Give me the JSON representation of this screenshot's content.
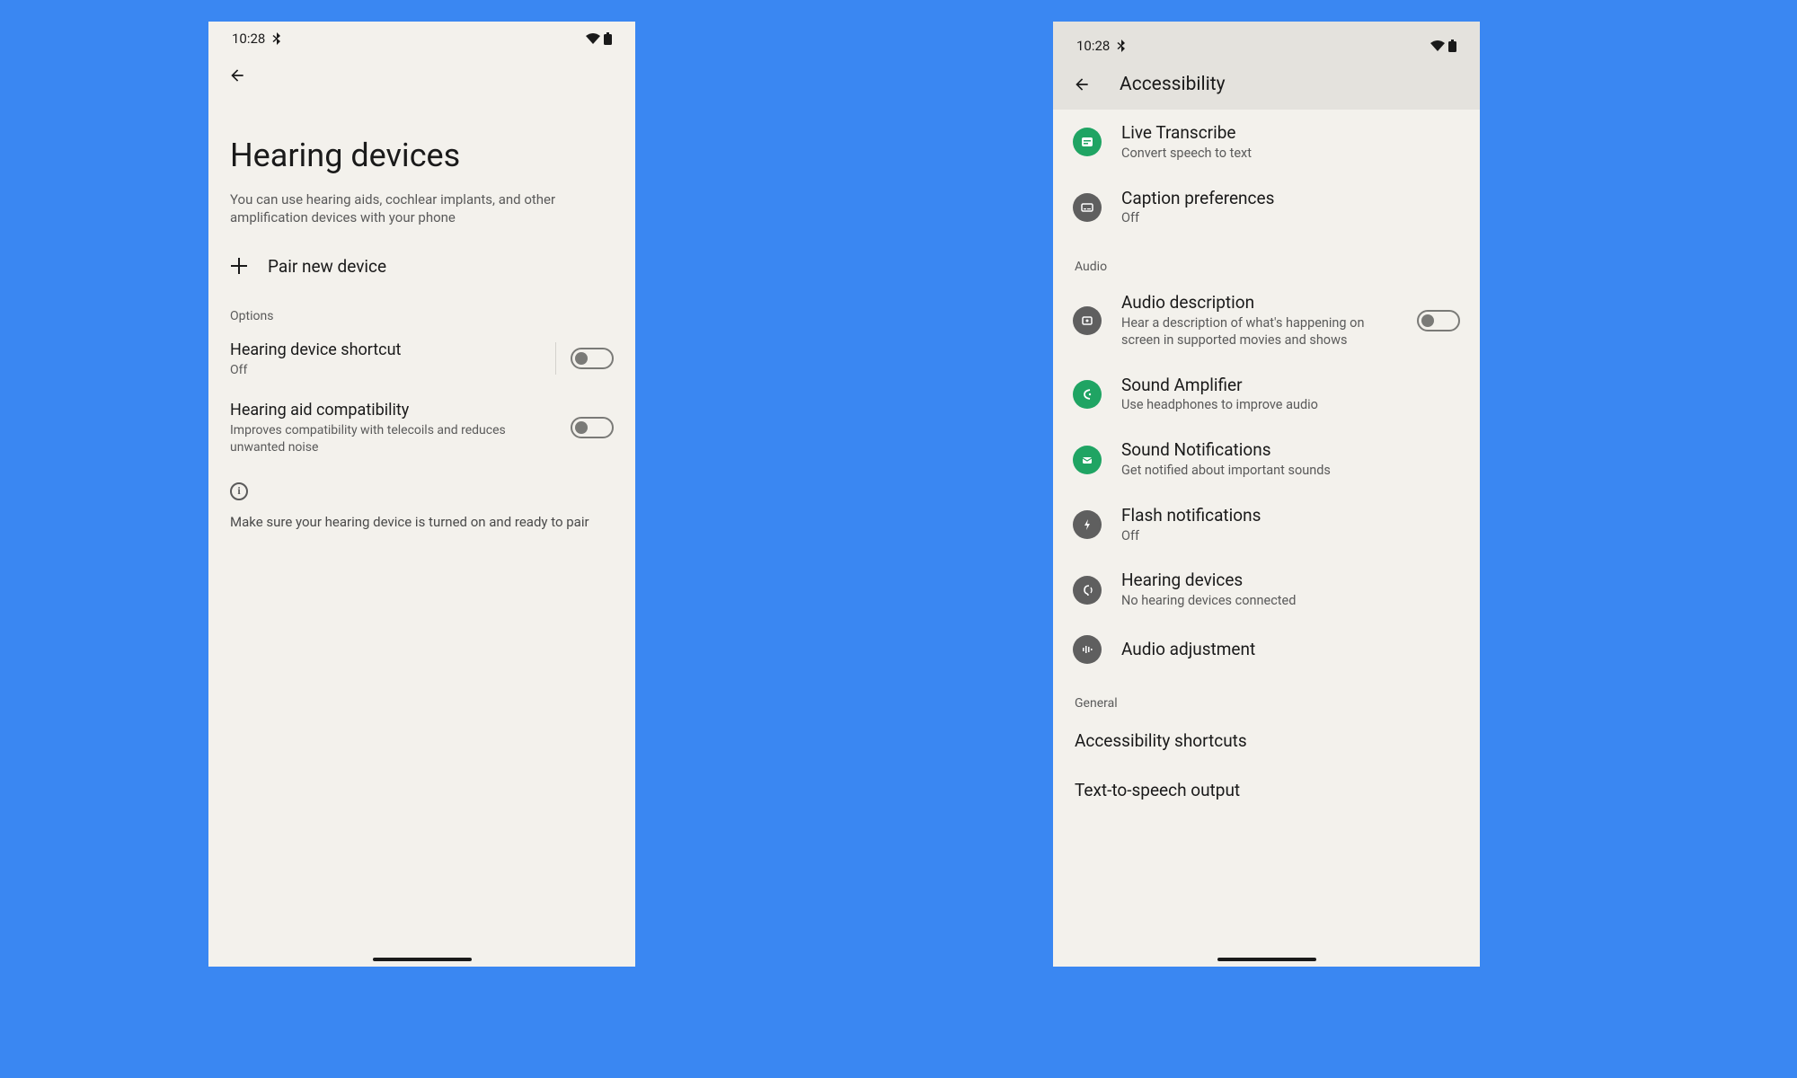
{
  "status": {
    "time": "10:28"
  },
  "left": {
    "title": "Hearing devices",
    "subtitle": "You can use hearing aids, cochlear implants, and other amplification devices with your phone",
    "pair": "Pair new device",
    "options_caption": "Options",
    "shortcut": {
      "title": "Hearing device shortcut",
      "sub": "Off"
    },
    "compat": {
      "title": "Hearing aid compatibility",
      "sub": "Improves compatibility with telecoils and reduces unwanted noise"
    },
    "info": "Make sure your hearing device is turned on and ready to pair"
  },
  "right": {
    "header": "Accessibility",
    "live_transcribe": {
      "title": "Live Transcribe",
      "sub": "Convert speech to text"
    },
    "caption_prefs": {
      "title": "Caption preferences",
      "sub": "Off"
    },
    "audio_caption": "Audio",
    "audio_desc": {
      "title": "Audio description",
      "sub": "Hear a description of what's happening on screen in supported movies and shows"
    },
    "sound_amp": {
      "title": "Sound Amplifier",
      "sub": "Use headphones to improve audio"
    },
    "sound_notif": {
      "title": "Sound Notifications",
      "sub": "Get notified about important sounds"
    },
    "flash": {
      "title": "Flash notifications",
      "sub": "Off"
    },
    "hearing": {
      "title": "Hearing devices",
      "sub": "No hearing devices connected"
    },
    "audio_adj": {
      "title": "Audio adjustment"
    },
    "general_caption": "General",
    "a11y_shortcuts": "Accessibility shortcuts",
    "tts": "Text-to-speech output"
  }
}
